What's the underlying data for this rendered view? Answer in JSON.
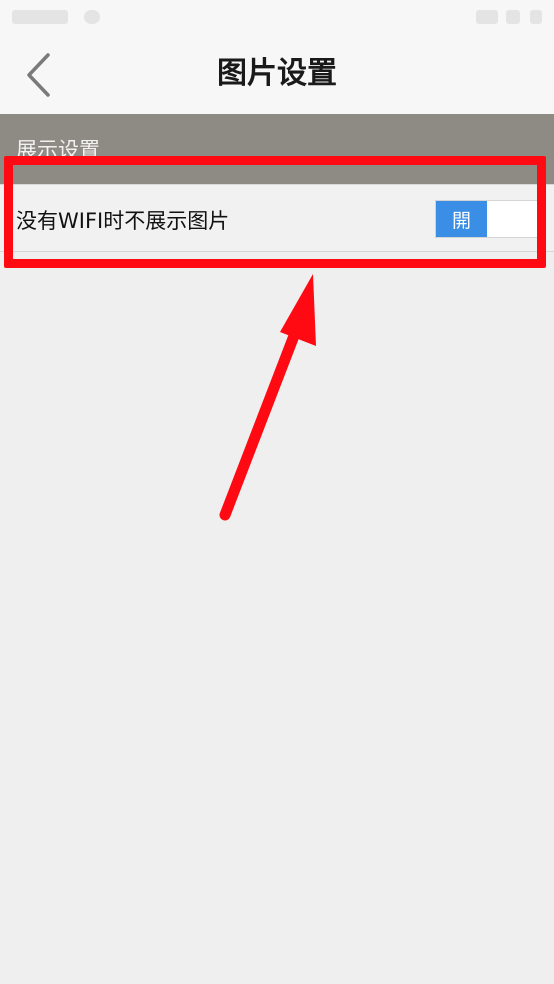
{
  "nav": {
    "title": "图片设置",
    "back_icon": "chevron-left-icon"
  },
  "section": {
    "header_label": "展示设置"
  },
  "setting": {
    "label": "没有WIFI时不展示图片",
    "toggle_label": "開",
    "toggle_state": "on",
    "accent_color": "#3a8ee6"
  },
  "annotation": {
    "highlight_color": "#ff0a12"
  }
}
